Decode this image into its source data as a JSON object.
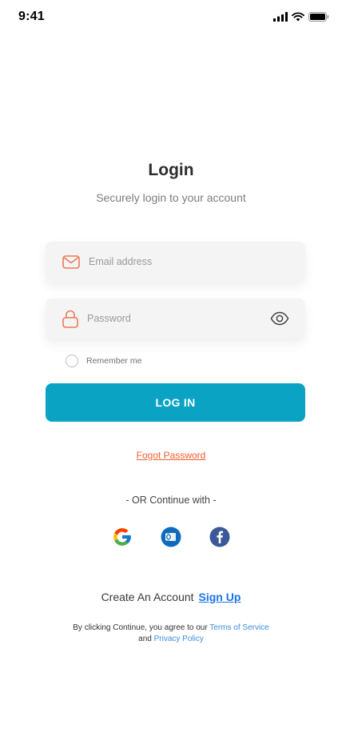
{
  "status_bar": {
    "time": "9:41",
    "icons": [
      "signal-icon",
      "wifi-icon",
      "battery-icon"
    ]
  },
  "header": {
    "title": "Login",
    "subtitle": "Securely login to your account"
  },
  "form": {
    "email": {
      "placeholder": "Email address",
      "value": "",
      "icon": "mail-icon"
    },
    "password": {
      "placeholder": "Password",
      "value": "",
      "icon": "lock-icon",
      "toggle_icon": "eye-icon"
    },
    "remember_me": {
      "label": "Remember me",
      "checked": false
    },
    "submit_label": "LOG IN",
    "forgot_label": "Fogot Password"
  },
  "social": {
    "divider_text": "- OR Continue with -",
    "providers": [
      "google-icon",
      "outlook-icon",
      "facebook-icon"
    ]
  },
  "signup": {
    "prompt": "Create An Account",
    "link_label": "Sign Up"
  },
  "legal": {
    "prefix": "By clicking Continue, you agree to our ",
    "terms_label": "Terms of Service",
    "and_text": "and ",
    "privacy_label": "Privacy Policy"
  },
  "colors": {
    "accent": "#0aa3c4",
    "icon_orange": "#f07a55",
    "forgot": "#f0602e",
    "link_blue": "#1a73e8"
  }
}
